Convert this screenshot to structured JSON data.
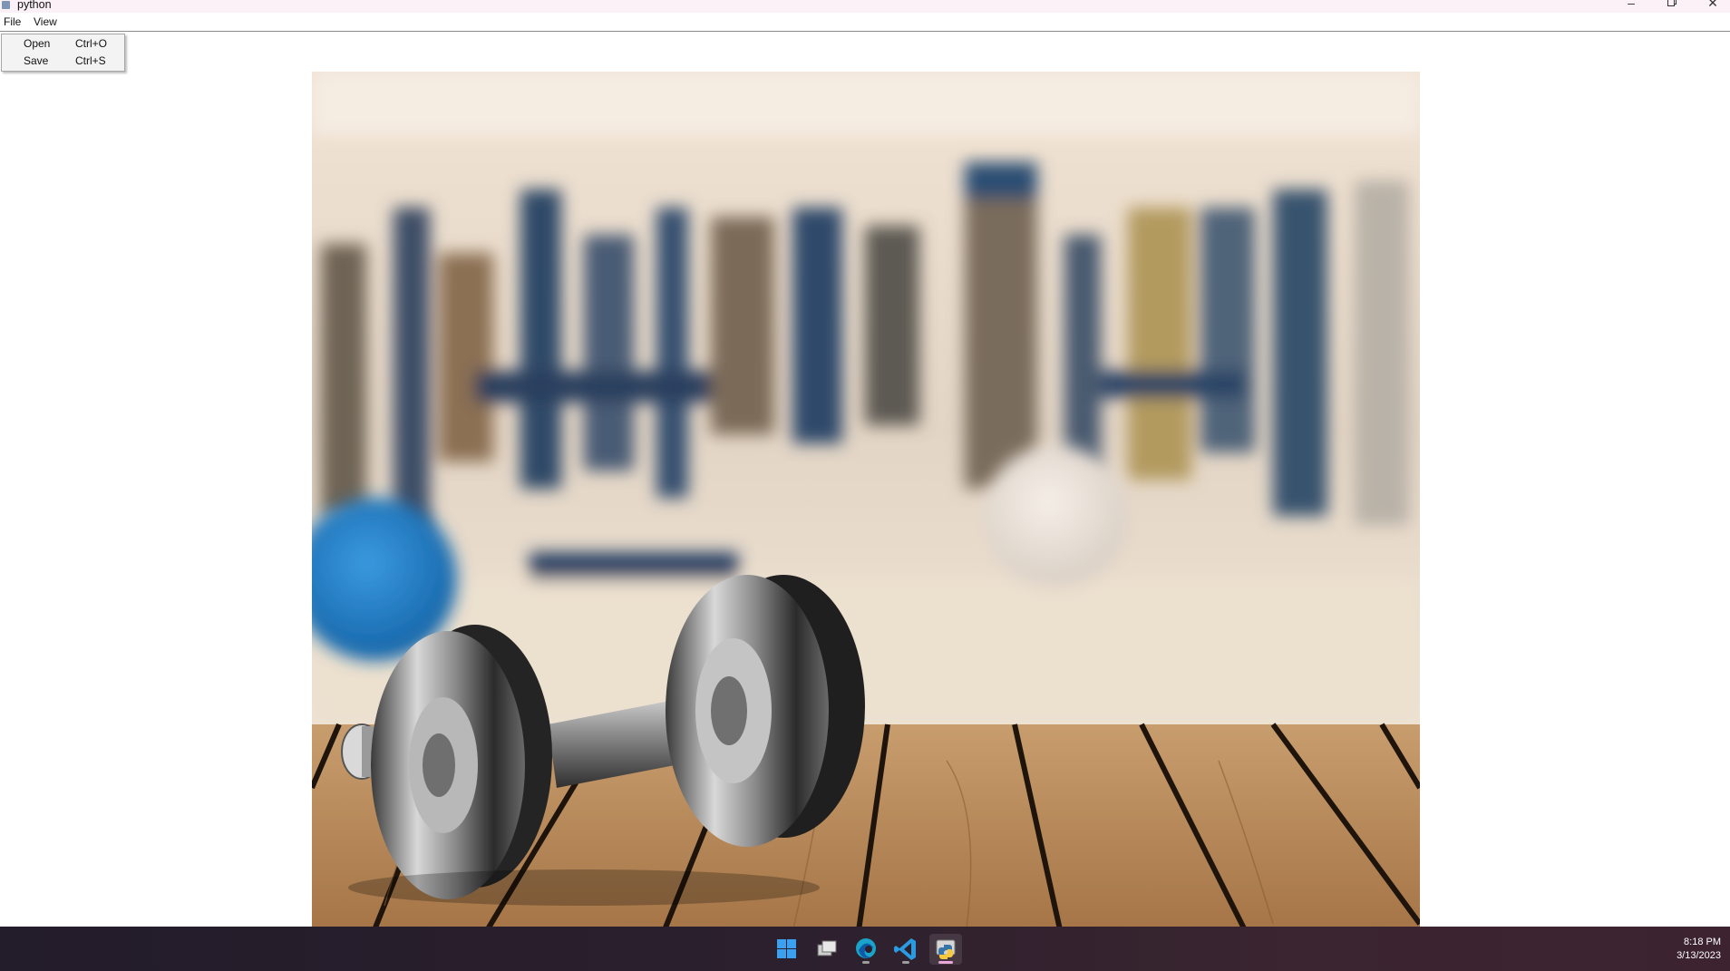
{
  "window": {
    "title": "python",
    "controls": [
      "minimize-icon",
      "maximize-icon",
      "close-icon"
    ]
  },
  "menubar": {
    "items": [
      {
        "label": "File"
      },
      {
        "label": "View"
      }
    ]
  },
  "file_menu": {
    "items": [
      {
        "label": "Open",
        "shortcut": "Ctrl+O"
      },
      {
        "label": "Save",
        "shortcut": "Ctrl+S"
      }
    ]
  },
  "canvas": {
    "image_icon": "dumbbell-gym-photo"
  },
  "taskbar": {
    "apps": [
      {
        "icon": "windows-start-icon"
      },
      {
        "icon": "task-view-icon"
      },
      {
        "icon": "edge-browser-icon"
      },
      {
        "icon": "vscode-icon"
      },
      {
        "icon": "python-icon",
        "active": true
      }
    ],
    "time": "8:18 PM",
    "date": "3/13/2023"
  },
  "colors": {
    "title_bar": "#fbf1f6",
    "menu_bg": "#ffffff",
    "dropdown_bg": "#f3f3f3",
    "taskbar": "#2a1f2d",
    "active_indicator": "#e9a6d6"
  }
}
